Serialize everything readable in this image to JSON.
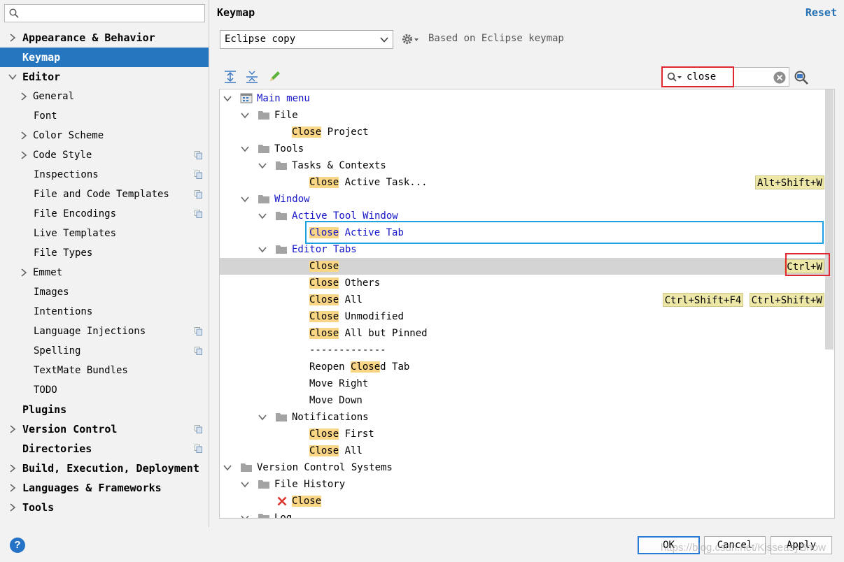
{
  "sidebar": {
    "search_value": "",
    "items": [
      {
        "label": "Appearance & Behavior",
        "top": true,
        "arrow": "right"
      },
      {
        "label": "Keymap",
        "top": true,
        "selected": true
      },
      {
        "label": "Editor",
        "top": true,
        "arrow": "down"
      },
      {
        "label": "General",
        "arrow": "right"
      },
      {
        "label": "Font"
      },
      {
        "label": "Color Scheme",
        "arrow": "right"
      },
      {
        "label": "Code Style",
        "arrow": "right",
        "copy": true
      },
      {
        "label": "Inspections",
        "copy": true
      },
      {
        "label": "File and Code Templates",
        "copy": true
      },
      {
        "label": "File Encodings",
        "copy": true
      },
      {
        "label": "Live Templates"
      },
      {
        "label": "File Types"
      },
      {
        "label": "Emmet",
        "arrow": "right"
      },
      {
        "label": "Images"
      },
      {
        "label": "Intentions"
      },
      {
        "label": "Language Injections",
        "copy": true
      },
      {
        "label": "Spelling",
        "copy": true
      },
      {
        "label": "TextMate Bundles"
      },
      {
        "label": "TODO"
      },
      {
        "label": "Plugins",
        "top": true
      },
      {
        "label": "Version Control",
        "top": true,
        "arrow": "right",
        "copy": true
      },
      {
        "label": "Directories",
        "top": true,
        "copy": true
      },
      {
        "label": "Build, Execution, Deployment",
        "top": true,
        "arrow": "right"
      },
      {
        "label": "Languages & Frameworks",
        "top": true,
        "arrow": "right"
      },
      {
        "label": "Tools",
        "top": true,
        "arrow": "right"
      }
    ]
  },
  "header": {
    "title": "Keymap",
    "reset": "Reset",
    "keymap_selected": "Eclipse copy",
    "based_on": "Based on Eclipse keymap"
  },
  "search": {
    "value": "close"
  },
  "tree": [
    {
      "indent": 0,
      "arrow": "down",
      "icon": "menu",
      "blue": true,
      "parts": [
        [
          "Main menu",
          false
        ]
      ]
    },
    {
      "indent": 1,
      "arrow": "down",
      "icon": "folder",
      "parts": [
        [
          "File",
          false
        ]
      ]
    },
    {
      "indent": 2,
      "parts": [
        [
          "Close",
          true
        ],
        [
          " Project",
          false
        ]
      ]
    },
    {
      "indent": 1,
      "arrow": "down",
      "icon": "folder",
      "parts": [
        [
          "Tools",
          false
        ]
      ]
    },
    {
      "indent": 2,
      "arrow": "down",
      "icon": "folder",
      "parts": [
        [
          "Tasks & Contexts",
          false
        ]
      ]
    },
    {
      "indent": 3,
      "parts": [
        [
          "Close",
          true
        ],
        [
          " Active Task...",
          false
        ]
      ],
      "shortcuts": [
        "Alt+Shift+W"
      ]
    },
    {
      "indent": 1,
      "arrow": "down",
      "icon": "folder",
      "blue": true,
      "parts": [
        [
          "Window",
          false
        ]
      ]
    },
    {
      "indent": 2,
      "arrow": "down",
      "icon": "folder",
      "blue": true,
      "parts": [
        [
          "Active Tool Window",
          false
        ]
      ]
    },
    {
      "indent": 3,
      "blue": true,
      "parts": [
        [
          "Close",
          true
        ],
        [
          " Active Tab",
          false
        ]
      ]
    },
    {
      "indent": 2,
      "arrow": "down",
      "icon": "folder",
      "blue": true,
      "parts": [
        [
          "Editor Tabs",
          false
        ]
      ]
    },
    {
      "indent": 3,
      "selected": true,
      "parts": [
        [
          "Close",
          true
        ]
      ],
      "shortcuts": [
        "Ctrl+W"
      ]
    },
    {
      "indent": 3,
      "parts": [
        [
          "Close",
          true
        ],
        [
          " Others",
          false
        ]
      ]
    },
    {
      "indent": 3,
      "parts": [
        [
          "Close",
          true
        ],
        [
          " All",
          false
        ]
      ],
      "shortcuts": [
        "Ctrl+Shift+F4",
        "Ctrl+Shift+W"
      ]
    },
    {
      "indent": 3,
      "parts": [
        [
          "Close",
          true
        ],
        [
          " Unmodified",
          false
        ]
      ]
    },
    {
      "indent": 3,
      "parts": [
        [
          "Close",
          true
        ],
        [
          " All but Pinned",
          false
        ]
      ]
    },
    {
      "indent": 3,
      "parts": [
        [
          "-------------",
          false
        ]
      ]
    },
    {
      "indent": 3,
      "parts": [
        [
          "Reopen ",
          false
        ],
        [
          "Close",
          true
        ],
        [
          "d Tab",
          false
        ]
      ]
    },
    {
      "indent": 3,
      "parts": [
        [
          "Move Right",
          false
        ]
      ]
    },
    {
      "indent": 3,
      "parts": [
        [
          "Move Down",
          false
        ]
      ]
    },
    {
      "indent": 2,
      "arrow": "down",
      "icon": "folder",
      "parts": [
        [
          "Notifications",
          false
        ]
      ]
    },
    {
      "indent": 3,
      "parts": [
        [
          "Close",
          true
        ],
        [
          " First",
          false
        ]
      ]
    },
    {
      "indent": 3,
      "parts": [
        [
          "Close",
          true
        ],
        [
          " All",
          false
        ]
      ]
    },
    {
      "indent": 0,
      "arrow": "down",
      "icon": "folder",
      "parts": [
        [
          "Version Control Systems",
          false
        ]
      ]
    },
    {
      "indent": 1,
      "arrow": "down",
      "icon": "folder",
      "parts": [
        [
          "File History",
          false
        ]
      ]
    },
    {
      "indent": 2,
      "xicon": true,
      "parts": [
        [
          "Close",
          true
        ]
      ]
    },
    {
      "indent": 1,
      "arrow": "down",
      "icon": "folder",
      "parts": [
        [
          "Log",
          false
        ]
      ]
    }
  ],
  "footer": {
    "ok": "OK",
    "cancel": "Cancel",
    "apply": "Apply",
    "help": "?"
  },
  "watermark": "https://blog.csdn.net/KisseasyBnow",
  "colors": {
    "accent": "#2675bf",
    "match": "#f9d586",
    "shortcut": "#ede8a8",
    "red_box": "#e0282e",
    "cyan_box": "#1ba1e2"
  }
}
